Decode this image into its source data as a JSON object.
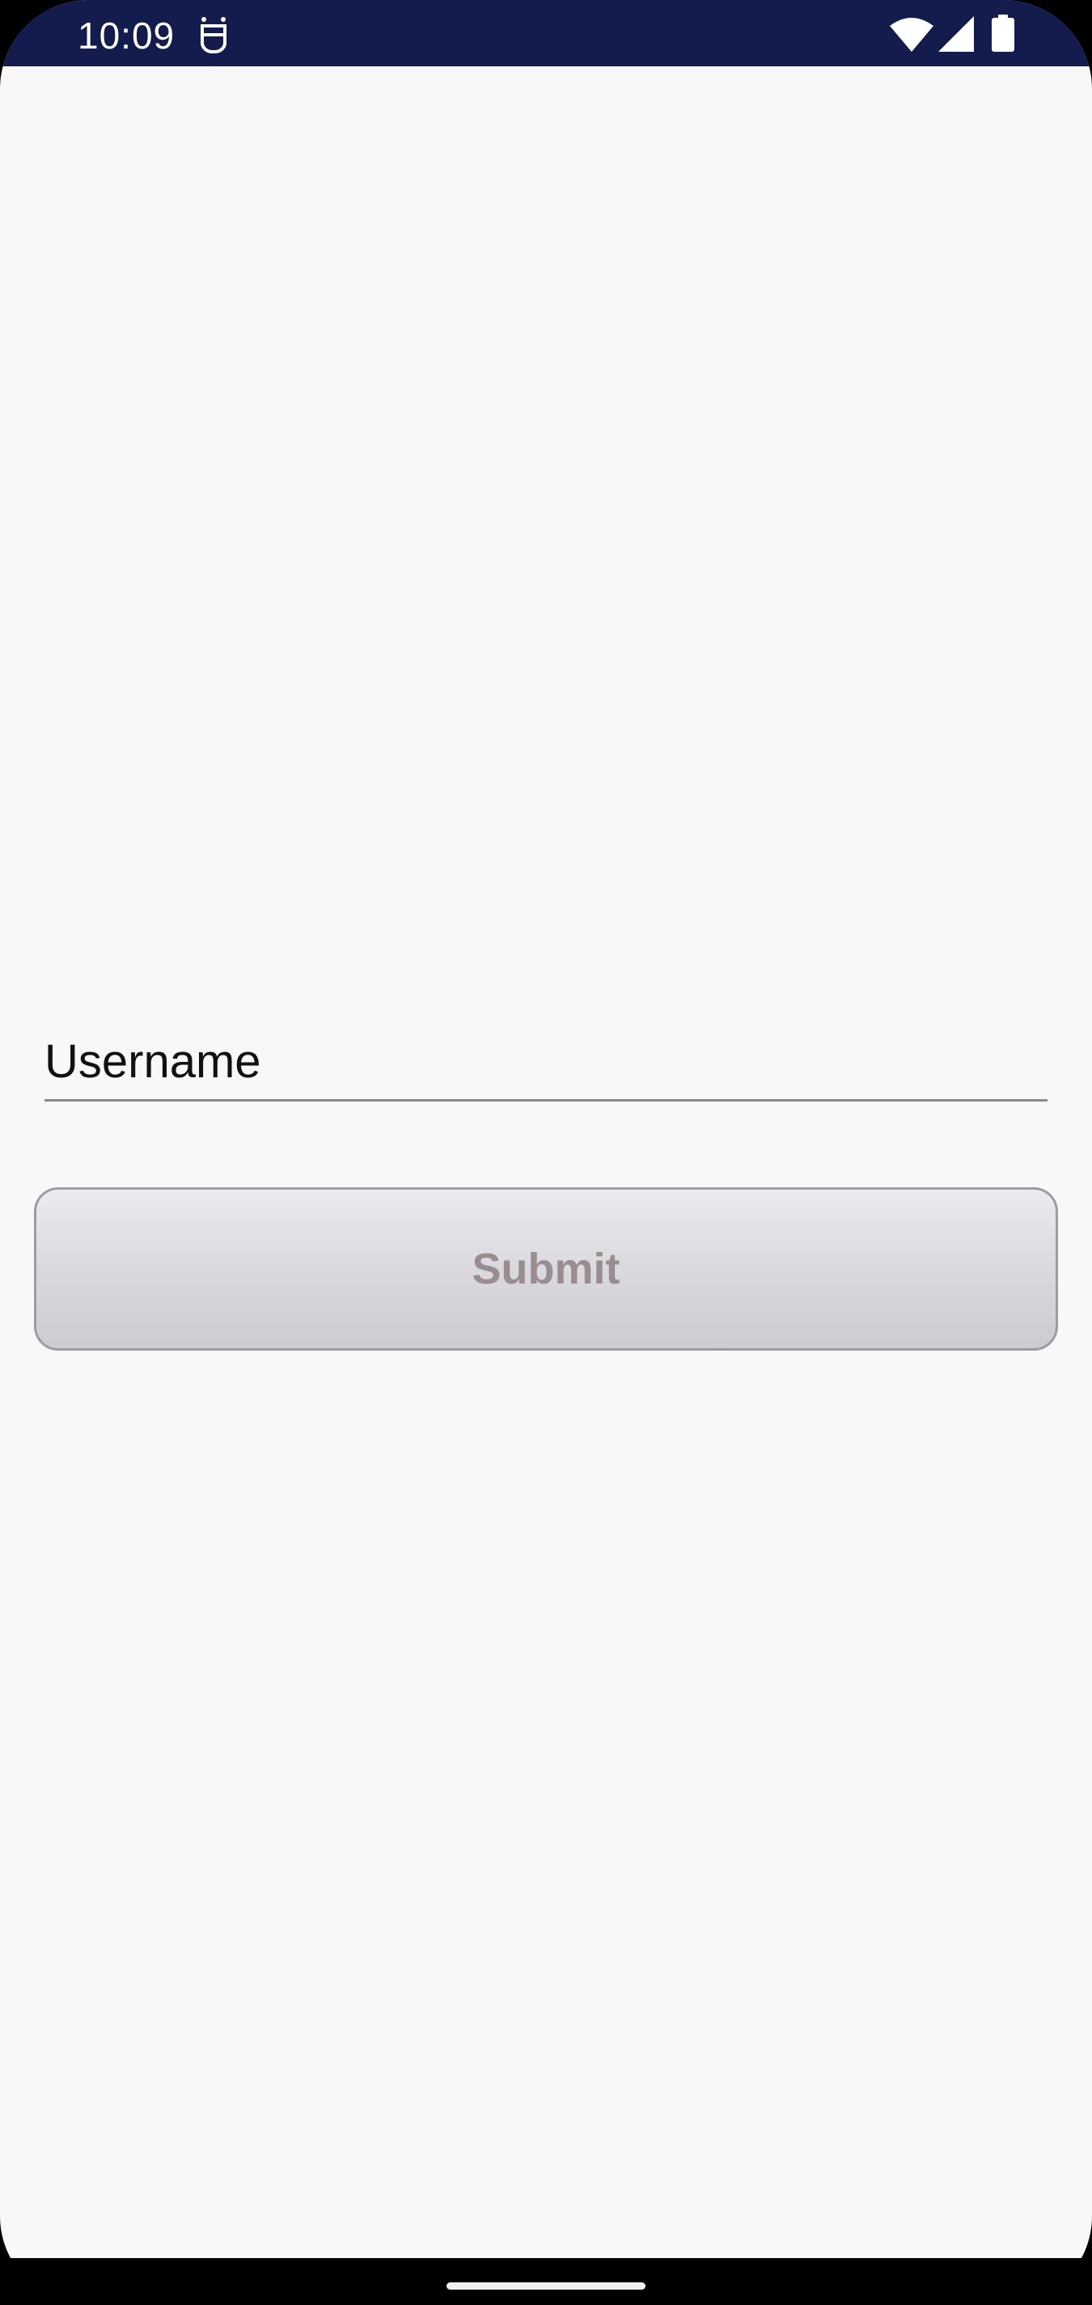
{
  "status_bar": {
    "time": "10:09",
    "background_color": "#141b4d",
    "icons": [
      "notification-icon",
      "wifi-icon",
      "signal-icon",
      "battery-icon"
    ]
  },
  "form": {
    "username_field": {
      "value": "",
      "placeholder": "Username"
    },
    "submit_button": {
      "label": "Submit",
      "enabled": false
    }
  },
  "nav_bar": {
    "home_handle": "home-handle"
  }
}
